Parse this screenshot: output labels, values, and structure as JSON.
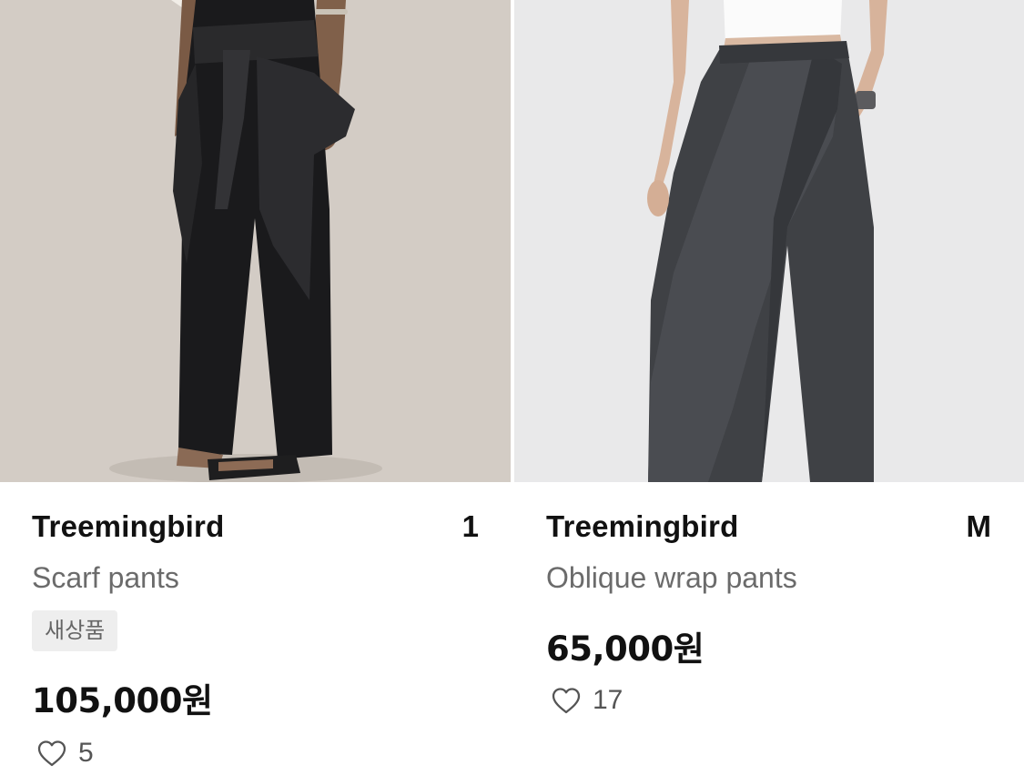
{
  "products": [
    {
      "brand": "Treemingbird",
      "size": "1",
      "name": "Scarf pants",
      "badge": "새상품",
      "price": "105,000원",
      "likes": "5",
      "icons": {
        "like": "heart-outline-icon"
      }
    },
    {
      "brand": "Treemingbird",
      "size": "M",
      "name": "Oblique wrap pants",
      "price": "65,000원",
      "likes": "17",
      "icons": {
        "like": "heart-outline-icon"
      }
    }
  ],
  "colors": {
    "text_primary": "#111111",
    "text_secondary": "#6b6b6b",
    "badge_background": "#eeeeee"
  }
}
